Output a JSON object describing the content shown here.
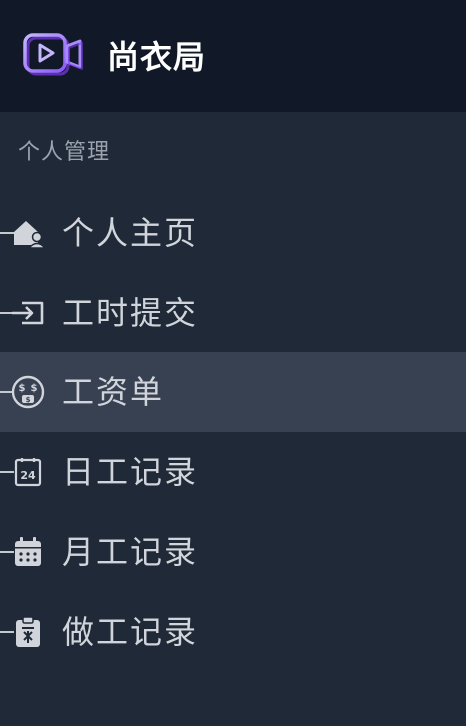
{
  "brand": {
    "name": "尚衣局",
    "logo_icon": "camera-play-logo-icon",
    "logo_color": "#a78bfa"
  },
  "section": {
    "title": "个人管理"
  },
  "nav": {
    "items": [
      {
        "label": "个人主页",
        "icon": "home-user-icon",
        "active": false
      },
      {
        "label": "工时提交",
        "icon": "login-arrow-icon",
        "active": false
      },
      {
        "label": "工资单",
        "icon": "money-face-icon",
        "active": true
      },
      {
        "label": "日工记录",
        "icon": "calendar-24-icon",
        "active": false
      },
      {
        "label": "月工记录",
        "icon": "calendar-month-icon",
        "active": false
      },
      {
        "label": "做工记录",
        "icon": "clipboard-task-icon",
        "active": false
      }
    ]
  },
  "colors": {
    "brand_bg": "#111827",
    "sidebar_bg": "#1f2937",
    "active_bg": "#374151",
    "text": "#d1d5db",
    "muted_text": "#9ca3af"
  }
}
